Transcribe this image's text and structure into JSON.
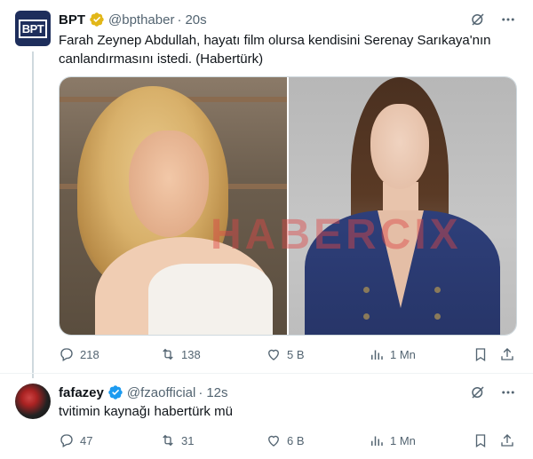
{
  "tweets": [
    {
      "author": {
        "name": "BPT",
        "handle": "@bpthaber",
        "verified": "gold",
        "avatar_text": "BPT"
      },
      "time": "20s",
      "text": "Farah Zeynep Abdullah, hayatı film olursa kendisini Serenay Sarıkaya'nın canlandırmasını istedi. (Habertürk)",
      "media_watermark": "HABERCIX",
      "stats": {
        "replies": "218",
        "retweets": "138",
        "likes": "5 B",
        "views": "1 Mn"
      }
    },
    {
      "author": {
        "name": "fafazey",
        "handle": "@fzaofficial",
        "verified": "blue"
      },
      "time": "12s",
      "text": "tvitimin kaynağı habertürk mü",
      "stats": {
        "replies": "47",
        "retweets": "31",
        "likes": "6 B",
        "views": "1 Mn"
      }
    }
  ],
  "ui": {
    "dot": "·"
  },
  "colors": {
    "gold_badge": "#e2b719",
    "blue_badge": "#1d9bf0",
    "muted": "#536471"
  },
  "icons": [
    "grok-icon",
    "more-icon",
    "reply-icon",
    "retweet-icon",
    "like-icon",
    "views-icon",
    "bookmark-icon",
    "share-icon"
  ]
}
